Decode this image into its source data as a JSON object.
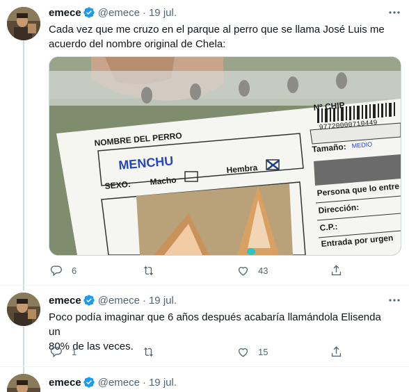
{
  "tweets": [
    {
      "name": "emece",
      "handle": "@emece",
      "dot": "·",
      "date": "19 jul.",
      "text": "Cada vez que me cruzo en el parque al perro que se llama José Luis me\nacuerdo del nombre original de Chela:",
      "media": {
        "chip_label": "Nº CHIP",
        "chip_number": "97720000710449",
        "name_label": "NOMBRE DEL PERRO",
        "name_value": "MENCHU",
        "size_label": "Tamaño:",
        "size_value": "MEDIO",
        "sex_label": "SEXO:",
        "male_label": "Macho",
        "female_label": "Hembra",
        "person_label": "Persona que lo entre",
        "address_label": "Dirección:",
        "cp_label": "C.P.:",
        "emergency_label": "Entrada por urgen"
      },
      "actions": {
        "replies": "6",
        "retweets": "",
        "likes": "43"
      }
    },
    {
      "name": "emece",
      "handle": "@emece",
      "dot": "·",
      "date": "19 jul.",
      "text": "Poco podía imaginar que 6 años después acabaría llamándola Elisenda un\n80% de las veces.",
      "actions": {
        "replies": "1",
        "retweets": "",
        "likes": "15"
      }
    },
    {
      "name": "emece",
      "handle": "@emece",
      "dot": "·",
      "date": "19 jul."
    }
  ],
  "colors": {
    "verified": "#1d9bf0",
    "secondary_text": "#536471",
    "thread_line": "#cfd9de"
  }
}
